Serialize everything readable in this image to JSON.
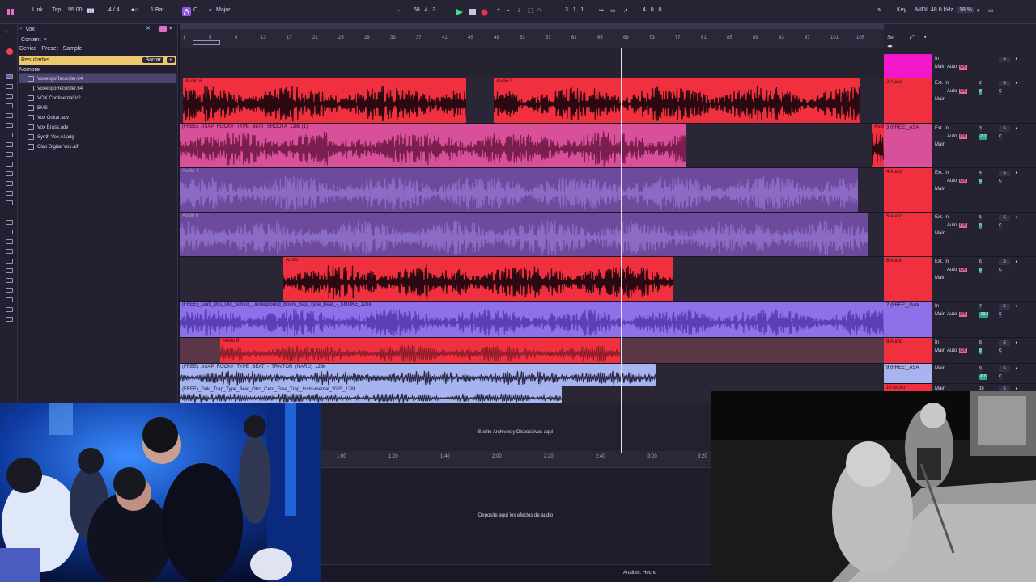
{
  "transport": {
    "link": "Link",
    "tap": "Tap",
    "tempo": "95.00",
    "meter": "4 / 4",
    "quant": "1 Bar",
    "key": "C",
    "scale": "Major",
    "pos": "68 . 4 . 3",
    "loop_start": "3 . 1 . 1",
    "loop_len": "4 . 0 . 0",
    "key_label": "Key",
    "midi_label": "MIDI",
    "sample_rate": "48.0 kHz",
    "cpu": "18 %"
  },
  "browser": {
    "search": "vox",
    "content_label": "Content",
    "filters": [
      "Device",
      "Preset",
      "Sample"
    ],
    "results_label": "Resultados",
    "clear_label": "Borrar",
    "add_label": "+",
    "column": "Nombre",
    "items": [
      "VoxengoRecorder.64",
      "VoxengoRecorder.64",
      "VOX Continental V2",
      "BMS",
      "Vox Guitar.adv",
      "Vox Brass.adv",
      "Synth Vox AI.adg",
      "Clap Digital Vox.aif"
    ]
  },
  "ruler": {
    "ticks": [
      "1",
      "5",
      "9",
      "13",
      "17",
      "21",
      "25",
      "29",
      "33",
      "37",
      "41",
      "45",
      "49",
      "53",
      "57",
      "61",
      "65",
      "69",
      "73",
      "77",
      "81",
      "85",
      "89",
      "93",
      "97",
      "101",
      "105"
    ],
    "set_label": "Set"
  },
  "clips": [
    {
      "label": "Audio 6",
      "color": "#f0303f"
    },
    {
      "label": "Audio 5",
      "color": "#f0303f"
    },
    {
      "label": "(FREE)_ASAP_ROCKY_TYPE_BEAT_SHOOTA_128k (1)",
      "color": "#d8509a"
    },
    {
      "label": "Audio 4",
      "color": "#6e4a9c"
    },
    {
      "label": "Audio 6",
      "color": "#6e4a9c"
    },
    {
      "label": "Audio",
      "color": "#f0303f"
    },
    {
      "label": "(FREE)_Dark_90s_Old_School_Underground_Boom_Bap_Type_Beat_-_SMOKE_128k",
      "color": "#8e70e8"
    },
    {
      "label": "Audio 6",
      "color": "#f0303f"
    },
    {
      "label": "(FREE)_ASAP_ROCKY_TYPE_BEAT_-_TRAITOR_(HARD)_128k",
      "color": "#a8b4f0"
    },
    {
      "label": "(FREE)_Duki_Trap_Type_Beat_Otro_Cero_Free_Trap_Instrumental_2025_128k",
      "color": "#a8b4f0"
    },
    {
      "label": "Audio",
      "color": "#f0303f"
    }
  ],
  "tracks": [
    {
      "name": "",
      "color": "#f018c8",
      "in": "In",
      "auto": "Auto",
      "off": "Off",
      "out": "Main",
      "num": "",
      "vol": "",
      "pan": ""
    },
    {
      "name": "2 Audio",
      "color": "#f0303f",
      "in": "Ext. In",
      "auto": "Auto",
      "off": "Off",
      "out": "Main",
      "num": "2",
      "vol": "0",
      "pan": "C"
    },
    {
      "name": "3 (FREE)_ASA",
      "color": "#d8509a",
      "in": "Ext. In",
      "auto": "Auto",
      "off": "Off",
      "out": "Main",
      "num": "3",
      "vol": "-2.2",
      "pan": "C"
    },
    {
      "name": "4 Audio",
      "color": "#f0303f",
      "in": "Ext. In",
      "auto": "Auto",
      "off": "Off",
      "out": "Main",
      "num": "4",
      "vol": "0",
      "pan": "C"
    },
    {
      "name": "5 Audio",
      "color": "#f0303f",
      "in": "Ext. In",
      "auto": "Auto",
      "off": "Off",
      "out": "Main",
      "num": "5",
      "vol": "0",
      "pan": "C"
    },
    {
      "name": "6 Audio",
      "color": "#f0303f",
      "in": "Ext. In",
      "auto": "Auto",
      "off": "Off",
      "out": "Main",
      "num": "6",
      "vol": "0",
      "pan": "C"
    },
    {
      "name": "7 (FREE)_Dark",
      "color": "#8e70e8",
      "in": "In",
      "auto": "Auto",
      "off": "Off",
      "out": "Main",
      "num": "7",
      "vol": "-10.0",
      "pan": "C"
    },
    {
      "name": "8 Audio",
      "color": "#f0303f",
      "in": "In",
      "auto": "Auto",
      "off": "Off",
      "out": "Main",
      "num": "8",
      "vol": "0",
      "pan": "C"
    },
    {
      "name": "9 (FREE)_ASA",
      "color": "#a8b4f0",
      "in": "Main",
      "auto": "",
      "off": "",
      "out": "",
      "num": "9",
      "vol": "-6.0",
      "pan": "C"
    },
    {
      "name": "10 Audio",
      "color": "#f0303f",
      "in": "Main",
      "auto": "",
      "off": "",
      "out": "",
      "num": "10",
      "vol": "",
      "pan": ""
    }
  ],
  "drop_files": "Suelte Archivos y Dispositivos aquí",
  "time_ticks": [
    "1:00",
    "1:20",
    "1:40",
    "2:00",
    "2:20",
    "2:40",
    "3:00",
    "3:20"
  ],
  "drop_effects": "Deposite aquí los efectos de audio",
  "status": "Análisis: Hecho"
}
